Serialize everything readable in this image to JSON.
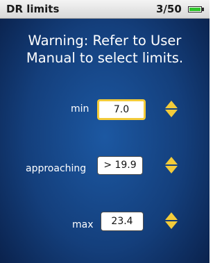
{
  "status_bar": {
    "title": "DR limits",
    "page_indicator": "3/50",
    "battery_icon": "battery-icon",
    "battery_level": 1.0
  },
  "warning": {
    "line1": "Warning: Refer to User",
    "line2": "Manual to select limits."
  },
  "limits": [
    {
      "label": "min",
      "value": "7.0",
      "selected": true,
      "control_icon": "up-down-arrows-icon"
    },
    {
      "label": "approaching",
      "value": "> 19.9",
      "selected": false,
      "control_icon": "up-down-arrows-icon"
    },
    {
      "label": "max",
      "value": "23.4",
      "selected": false,
      "control_icon": "up-down-arrows-icon"
    }
  ],
  "colors": {
    "background": "#143f7c",
    "accent": "#f3cb3a",
    "text": "#ffffff",
    "status_bar": "#e6e6e6",
    "battery": "#2fc52b"
  }
}
